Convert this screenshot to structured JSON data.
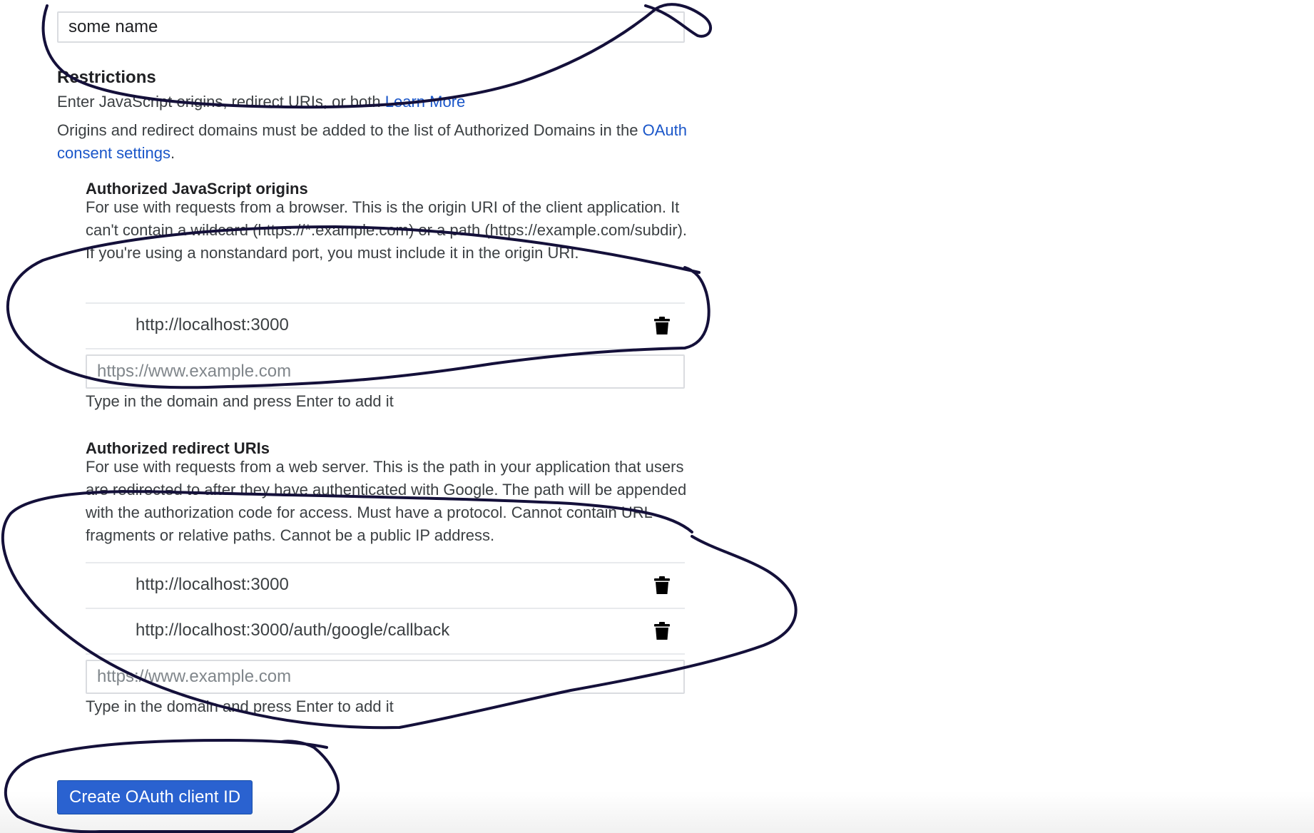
{
  "name_field": {
    "value": "some name"
  },
  "restrictions": {
    "heading": "Restrictions",
    "intro_text": "Enter JavaScript origins, redirect URIs, or both",
    "learn_more": "Learn More",
    "domains_text": "Origins and redirect domains must be added to the list of Authorized Domains in the",
    "consent_link": "OAuth consent settings",
    "consent_suffix": "."
  },
  "js_origins": {
    "heading": "Authorized JavaScript origins",
    "description": "For use with requests from a browser. This is the origin URI of the client application. It can't contain a wildcard (https://*.example.com) or a path (https://example.com/subdir). If you're using a nonstandard port, you must include it in the origin URI.",
    "items": [
      "http://localhost:3000"
    ],
    "placeholder": "https://www.example.com",
    "hint": "Type in the domain and press Enter to add it"
  },
  "redirect_uris": {
    "heading": "Authorized redirect URIs",
    "description": "For use with requests from a web server. This is the path in your application that users are redirected to after they have authenticated with Google. The path will be appended with the authorization code for access. Must have a protocol. Cannot contain URL fragments or relative paths. Cannot be a public IP address.",
    "items": [
      "http://localhost:3000",
      "http://localhost:3000/auth/google/callback"
    ],
    "placeholder": "https://www.example.com",
    "hint": "Type in the domain and press Enter to add it"
  },
  "create_button": {
    "label": "Create OAuth client ID"
  },
  "icons": {
    "delete": "trash-icon"
  },
  "colors": {
    "link": "#1a56c9",
    "button": "#2a62d0",
    "annotation_ink": "#14103a"
  }
}
